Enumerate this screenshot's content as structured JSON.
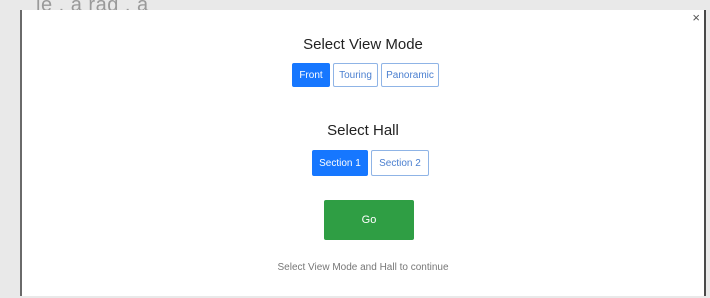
{
  "background": {
    "partial_text": "le ,  a rag ,  a"
  },
  "dialog": {
    "close_label": "×",
    "view_mode": {
      "title": "Select View Mode",
      "options": [
        "Front",
        "Touring",
        "Panoramic"
      ],
      "selected": "Front"
    },
    "hall": {
      "title": "Select Hall",
      "options": [
        "Section 1",
        "Section 2"
      ],
      "selected": "Section 1"
    },
    "go_label": "Go",
    "hint": "Select View Mode and Hall to continue"
  },
  "colors": {
    "accent": "#1677ff",
    "go_button": "#2f9e44"
  }
}
